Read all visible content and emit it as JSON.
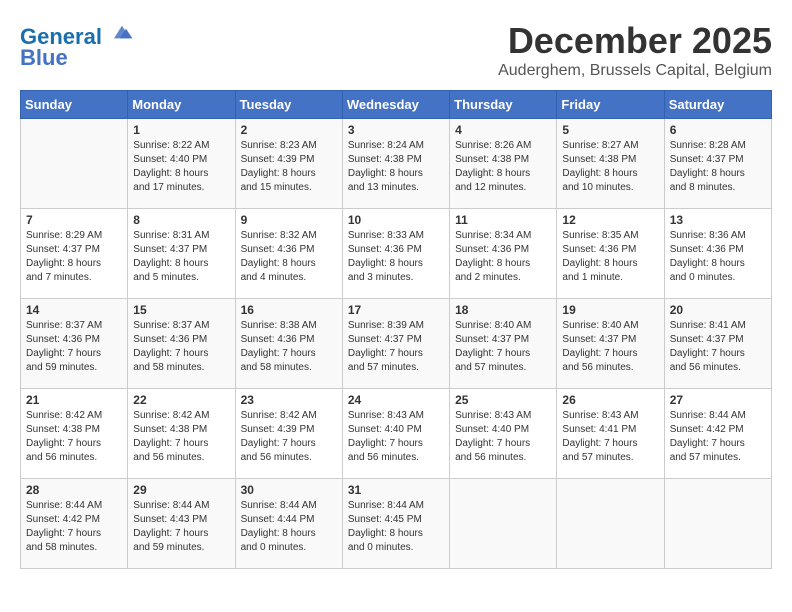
{
  "header": {
    "logo_line1": "General",
    "logo_line2": "Blue",
    "month_title": "December 2025",
    "location": "Auderghem, Brussels Capital, Belgium"
  },
  "days_of_week": [
    "Sunday",
    "Monday",
    "Tuesday",
    "Wednesday",
    "Thursday",
    "Friday",
    "Saturday"
  ],
  "weeks": [
    [
      {
        "day": "",
        "info": ""
      },
      {
        "day": "1",
        "info": "Sunrise: 8:22 AM\nSunset: 4:40 PM\nDaylight: 8 hours\nand 17 minutes."
      },
      {
        "day": "2",
        "info": "Sunrise: 8:23 AM\nSunset: 4:39 PM\nDaylight: 8 hours\nand 15 minutes."
      },
      {
        "day": "3",
        "info": "Sunrise: 8:24 AM\nSunset: 4:38 PM\nDaylight: 8 hours\nand 13 minutes."
      },
      {
        "day": "4",
        "info": "Sunrise: 8:26 AM\nSunset: 4:38 PM\nDaylight: 8 hours\nand 12 minutes."
      },
      {
        "day": "5",
        "info": "Sunrise: 8:27 AM\nSunset: 4:38 PM\nDaylight: 8 hours\nand 10 minutes."
      },
      {
        "day": "6",
        "info": "Sunrise: 8:28 AM\nSunset: 4:37 PM\nDaylight: 8 hours\nand 8 minutes."
      }
    ],
    [
      {
        "day": "7",
        "info": "Sunrise: 8:29 AM\nSunset: 4:37 PM\nDaylight: 8 hours\nand 7 minutes."
      },
      {
        "day": "8",
        "info": "Sunrise: 8:31 AM\nSunset: 4:37 PM\nDaylight: 8 hours\nand 5 minutes."
      },
      {
        "day": "9",
        "info": "Sunrise: 8:32 AM\nSunset: 4:36 PM\nDaylight: 8 hours\nand 4 minutes."
      },
      {
        "day": "10",
        "info": "Sunrise: 8:33 AM\nSunset: 4:36 PM\nDaylight: 8 hours\nand 3 minutes."
      },
      {
        "day": "11",
        "info": "Sunrise: 8:34 AM\nSunset: 4:36 PM\nDaylight: 8 hours\nand 2 minutes."
      },
      {
        "day": "12",
        "info": "Sunrise: 8:35 AM\nSunset: 4:36 PM\nDaylight: 8 hours\nand 1 minute."
      },
      {
        "day": "13",
        "info": "Sunrise: 8:36 AM\nSunset: 4:36 PM\nDaylight: 8 hours\nand 0 minutes."
      }
    ],
    [
      {
        "day": "14",
        "info": "Sunrise: 8:37 AM\nSunset: 4:36 PM\nDaylight: 7 hours\nand 59 minutes."
      },
      {
        "day": "15",
        "info": "Sunrise: 8:37 AM\nSunset: 4:36 PM\nDaylight: 7 hours\nand 58 minutes."
      },
      {
        "day": "16",
        "info": "Sunrise: 8:38 AM\nSunset: 4:36 PM\nDaylight: 7 hours\nand 58 minutes."
      },
      {
        "day": "17",
        "info": "Sunrise: 8:39 AM\nSunset: 4:37 PM\nDaylight: 7 hours\nand 57 minutes."
      },
      {
        "day": "18",
        "info": "Sunrise: 8:40 AM\nSunset: 4:37 PM\nDaylight: 7 hours\nand 57 minutes."
      },
      {
        "day": "19",
        "info": "Sunrise: 8:40 AM\nSunset: 4:37 PM\nDaylight: 7 hours\nand 56 minutes."
      },
      {
        "day": "20",
        "info": "Sunrise: 8:41 AM\nSunset: 4:37 PM\nDaylight: 7 hours\nand 56 minutes."
      }
    ],
    [
      {
        "day": "21",
        "info": "Sunrise: 8:42 AM\nSunset: 4:38 PM\nDaylight: 7 hours\nand 56 minutes."
      },
      {
        "day": "22",
        "info": "Sunrise: 8:42 AM\nSunset: 4:38 PM\nDaylight: 7 hours\nand 56 minutes."
      },
      {
        "day": "23",
        "info": "Sunrise: 8:42 AM\nSunset: 4:39 PM\nDaylight: 7 hours\nand 56 minutes."
      },
      {
        "day": "24",
        "info": "Sunrise: 8:43 AM\nSunset: 4:40 PM\nDaylight: 7 hours\nand 56 minutes."
      },
      {
        "day": "25",
        "info": "Sunrise: 8:43 AM\nSunset: 4:40 PM\nDaylight: 7 hours\nand 56 minutes."
      },
      {
        "day": "26",
        "info": "Sunrise: 8:43 AM\nSunset: 4:41 PM\nDaylight: 7 hours\nand 57 minutes."
      },
      {
        "day": "27",
        "info": "Sunrise: 8:44 AM\nSunset: 4:42 PM\nDaylight: 7 hours\nand 57 minutes."
      }
    ],
    [
      {
        "day": "28",
        "info": "Sunrise: 8:44 AM\nSunset: 4:42 PM\nDaylight: 7 hours\nand 58 minutes."
      },
      {
        "day": "29",
        "info": "Sunrise: 8:44 AM\nSunset: 4:43 PM\nDaylight: 7 hours\nand 59 minutes."
      },
      {
        "day": "30",
        "info": "Sunrise: 8:44 AM\nSunset: 4:44 PM\nDaylight: 8 hours\nand 0 minutes."
      },
      {
        "day": "31",
        "info": "Sunrise: 8:44 AM\nSunset: 4:45 PM\nDaylight: 8 hours\nand 0 minutes."
      },
      {
        "day": "",
        "info": ""
      },
      {
        "day": "",
        "info": ""
      },
      {
        "day": "",
        "info": ""
      }
    ]
  ]
}
